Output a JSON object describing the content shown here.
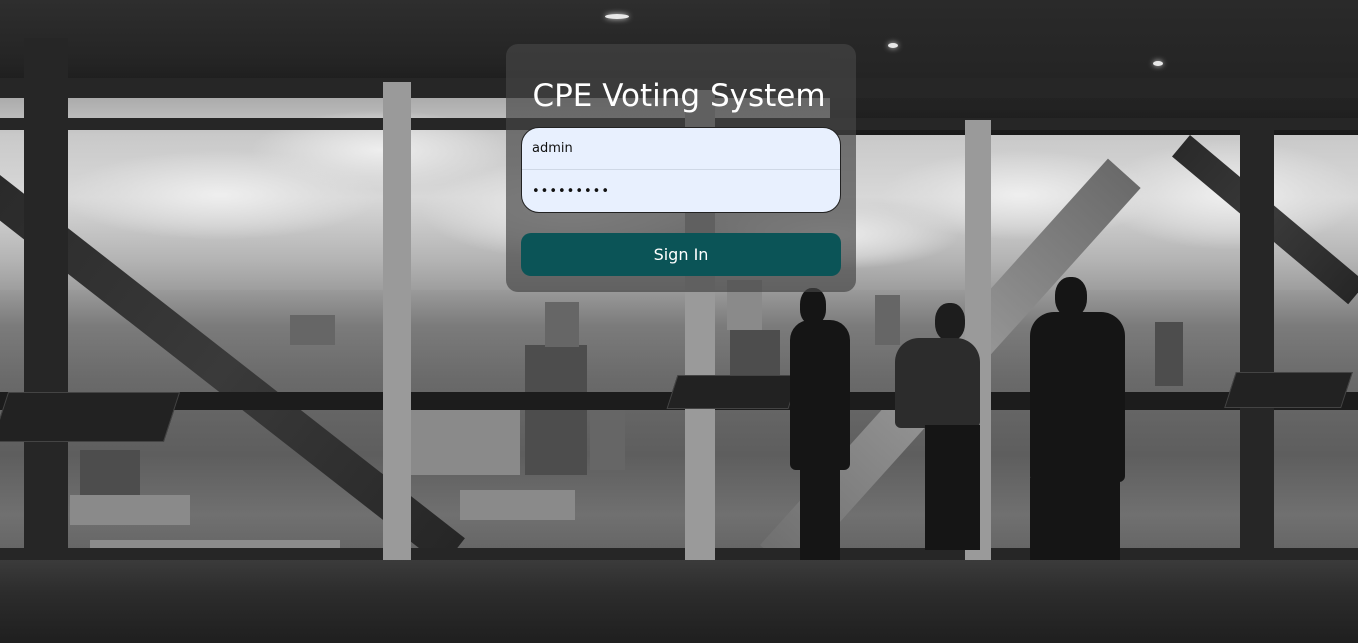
{
  "app": {
    "title": "CPE Voting System"
  },
  "login": {
    "username": {
      "value": "admin"
    },
    "password": {
      "value": "•••••••••"
    },
    "signin_label": "Sign In"
  },
  "theme": {
    "button_color": "#0b5457",
    "input_background": "#e8f0fe",
    "panel_background": "rgba(70,70,70,0.68)"
  },
  "background": {
    "description_icon": "office-cityscape-photo"
  }
}
